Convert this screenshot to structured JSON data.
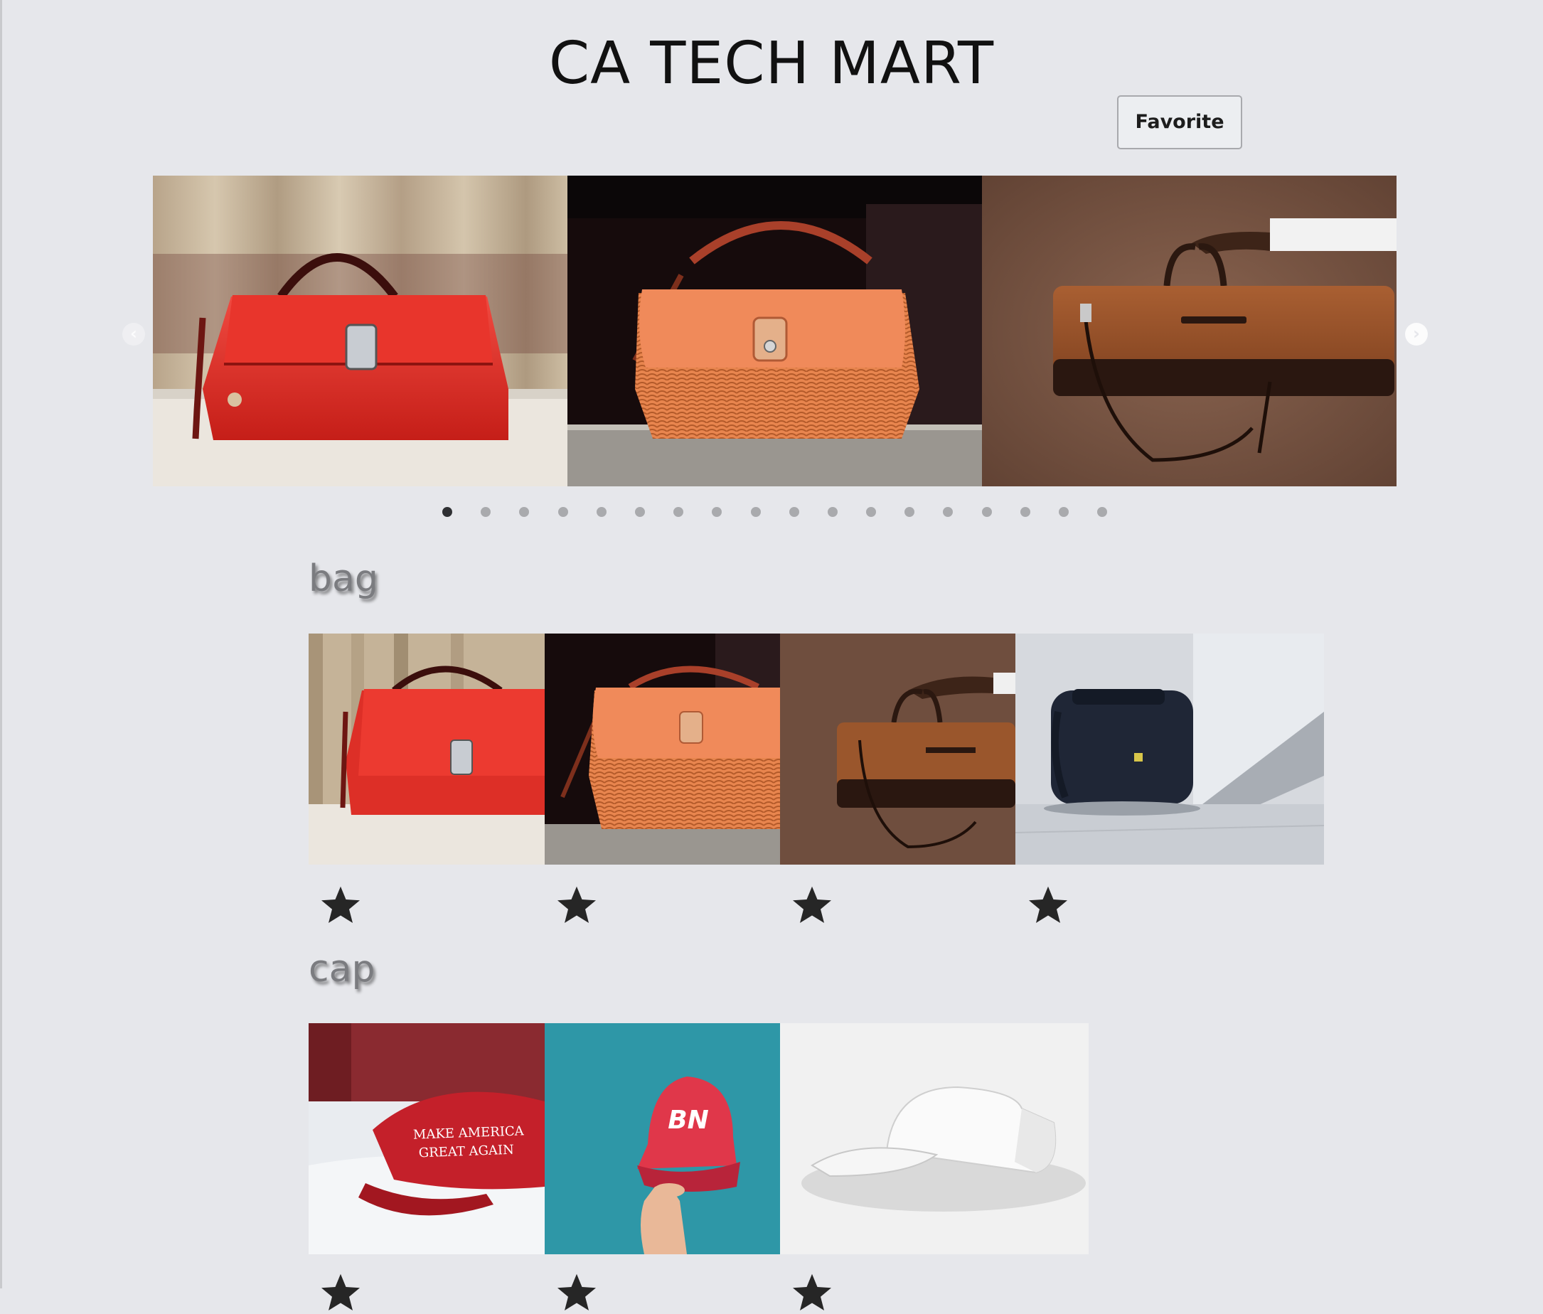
{
  "header": {
    "title": "CA TECH MART",
    "favorite_label": "Favorite"
  },
  "carousel": {
    "slides": [
      "red-handbag",
      "orange-wicker-handbag",
      "brown-leather-duffel"
    ],
    "dot_count": 18,
    "active_dot": 0,
    "prev_icon": "chevron-left-icon",
    "next_icon": "chevron-right-icon"
  },
  "categories": [
    {
      "name": "bag",
      "products": [
        "red-handbag",
        "orange-wicker-handbag",
        "brown-leather-duffel",
        "navy-backpack"
      ]
    },
    {
      "name": "cap",
      "products": [
        "red-slogan-cap",
        "red-logo-cap",
        "white-trucker-cap"
      ]
    }
  ],
  "icons": {
    "favorite_toggle": "star-icon"
  },
  "colors": {
    "background": "#e6e7eb",
    "star": "#262626",
    "section_title": "#7b7c80"
  }
}
